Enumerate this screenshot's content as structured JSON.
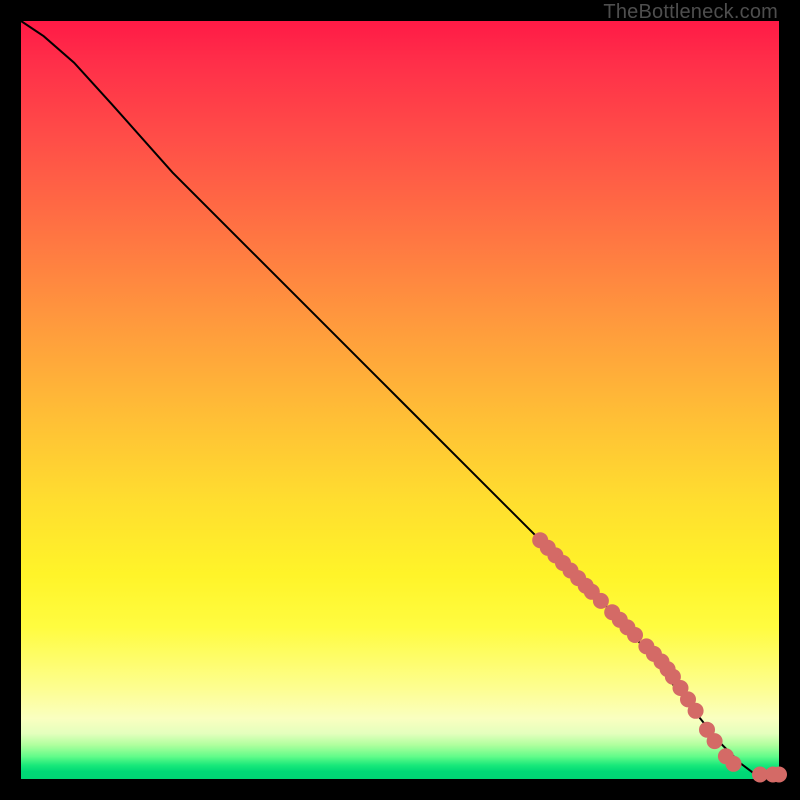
{
  "watermark": "TheBottleneck.com",
  "colors": {
    "marker": "#d46a66",
    "curve": "#000000",
    "axis_bg": "#000000"
  },
  "chart_data": {
    "type": "line",
    "title": "",
    "xlabel": "",
    "ylabel": "",
    "xlim": [
      0,
      100
    ],
    "ylim": [
      0,
      100
    ],
    "grid": false,
    "legend": false,
    "curve": [
      {
        "x": 0,
        "y": 100
      },
      {
        "x": 3,
        "y": 98
      },
      {
        "x": 7,
        "y": 94.5
      },
      {
        "x": 12,
        "y": 89
      },
      {
        "x": 20,
        "y": 80
      },
      {
        "x": 30,
        "y": 70
      },
      {
        "x": 40,
        "y": 60
      },
      {
        "x": 50,
        "y": 50
      },
      {
        "x": 60,
        "y": 40
      },
      {
        "x": 70,
        "y": 30
      },
      {
        "x": 80,
        "y": 20
      },
      {
        "x": 88,
        "y": 10
      },
      {
        "x": 92,
        "y": 5
      },
      {
        "x": 95,
        "y": 2
      },
      {
        "x": 97,
        "y": 0.5
      },
      {
        "x": 99,
        "y": 0.5
      },
      {
        "x": 100,
        "y": 0.5
      }
    ],
    "markers": [
      {
        "x": 68.5,
        "y": 31.5
      },
      {
        "x": 69.5,
        "y": 30.5
      },
      {
        "x": 70.5,
        "y": 29.5
      },
      {
        "x": 71.5,
        "y": 28.5
      },
      {
        "x": 72.5,
        "y": 27.5
      },
      {
        "x": 73.5,
        "y": 26.5
      },
      {
        "x": 74.5,
        "y": 25.5
      },
      {
        "x": 75.3,
        "y": 24.7
      },
      {
        "x": 76.5,
        "y": 23.5
      },
      {
        "x": 78.0,
        "y": 22.0
      },
      {
        "x": 79.0,
        "y": 21.0
      },
      {
        "x": 80.0,
        "y": 20.0
      },
      {
        "x": 81.0,
        "y": 19.0
      },
      {
        "x": 82.5,
        "y": 17.5
      },
      {
        "x": 83.5,
        "y": 16.5
      },
      {
        "x": 84.5,
        "y": 15.5
      },
      {
        "x": 85.3,
        "y": 14.5
      },
      {
        "x": 86.0,
        "y": 13.5
      },
      {
        "x": 87.0,
        "y": 12.0
      },
      {
        "x": 88.0,
        "y": 10.5
      },
      {
        "x": 89.0,
        "y": 9.0
      },
      {
        "x": 90.5,
        "y": 6.5
      },
      {
        "x": 91.5,
        "y": 5.0
      },
      {
        "x": 93.0,
        "y": 3.0
      },
      {
        "x": 94.0,
        "y": 2.0
      },
      {
        "x": 97.5,
        "y": 0.6
      },
      {
        "x": 99.2,
        "y": 0.6
      },
      {
        "x": 100.0,
        "y": 0.6
      }
    ]
  }
}
